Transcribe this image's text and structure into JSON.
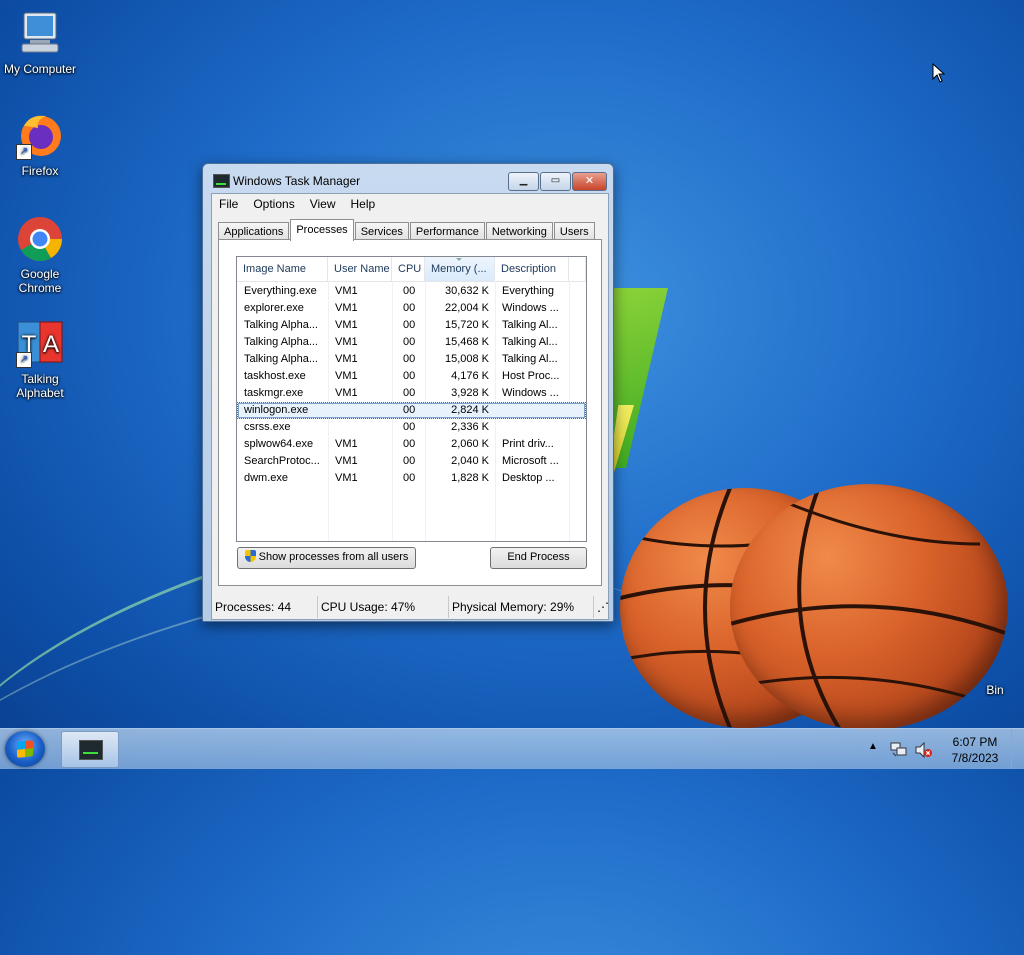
{
  "desktop": {
    "icons": [
      {
        "label": "My Computer"
      },
      {
        "label": "Firefox"
      },
      {
        "label": "Google Chrome"
      },
      {
        "label": "Talking Alphabet"
      }
    ],
    "recycle_bin_label": "Bin"
  },
  "window": {
    "title": "Windows Task Manager",
    "menu": [
      "File",
      "Options",
      "View",
      "Help"
    ],
    "tabs": [
      "Applications",
      "Processes",
      "Services",
      "Performance",
      "Networking",
      "Users"
    ],
    "active_tab": "Processes",
    "columns": [
      "Image Name",
      "User Name",
      "CPU",
      "Memory (...",
      "Description"
    ],
    "processes": [
      {
        "name": "Everything.exe",
        "user": "VM1",
        "cpu": "00",
        "memory": "30,632 K",
        "desc": "Everything"
      },
      {
        "name": "explorer.exe",
        "user": "VM1",
        "cpu": "00",
        "memory": "22,004 K",
        "desc": "Windows ..."
      },
      {
        "name": "Talking Alpha...",
        "user": "VM1",
        "cpu": "00",
        "memory": "15,720 K",
        "desc": "Talking Al..."
      },
      {
        "name": "Talking Alpha...",
        "user": "VM1",
        "cpu": "00",
        "memory": "15,468 K",
        "desc": "Talking Al..."
      },
      {
        "name": "Talking Alpha...",
        "user": "VM1",
        "cpu": "00",
        "memory": "15,008 K",
        "desc": "Talking Al..."
      },
      {
        "name": "taskhost.exe",
        "user": "VM1",
        "cpu": "00",
        "memory": "4,176 K",
        "desc": "Host Proc..."
      },
      {
        "name": "taskmgr.exe",
        "user": "VM1",
        "cpu": "00",
        "memory": "3,928 K",
        "desc": "Windows ..."
      },
      {
        "name": "winlogon.exe",
        "user": "",
        "cpu": "00",
        "memory": "2,824 K",
        "desc": ""
      },
      {
        "name": "csrss.exe",
        "user": "",
        "cpu": "00",
        "memory": "2,336 K",
        "desc": ""
      },
      {
        "name": "splwow64.exe",
        "user": "VM1",
        "cpu": "00",
        "memory": "2,060 K",
        "desc": "Print driv..."
      },
      {
        "name": "SearchProtoc...",
        "user": "VM1",
        "cpu": "00",
        "memory": "2,040 K",
        "desc": "Microsoft ..."
      },
      {
        "name": "dwm.exe",
        "user": "VM1",
        "cpu": "00",
        "memory": "1,828 K",
        "desc": "Desktop ..."
      }
    ],
    "selected_row": 7,
    "show_all_label": "Show processes from all users",
    "end_process_label": "End Process",
    "status": {
      "processes": "Processes: 44",
      "cpu": "CPU Usage: 47%",
      "memory": "Physical Memory: 29%"
    }
  },
  "taskbar": {
    "time": "6:07 PM",
    "date": "7/8/2023"
  },
  "colors": {
    "desktop_blue": "#1e6bc8",
    "selection": "#e8f2fd"
  }
}
